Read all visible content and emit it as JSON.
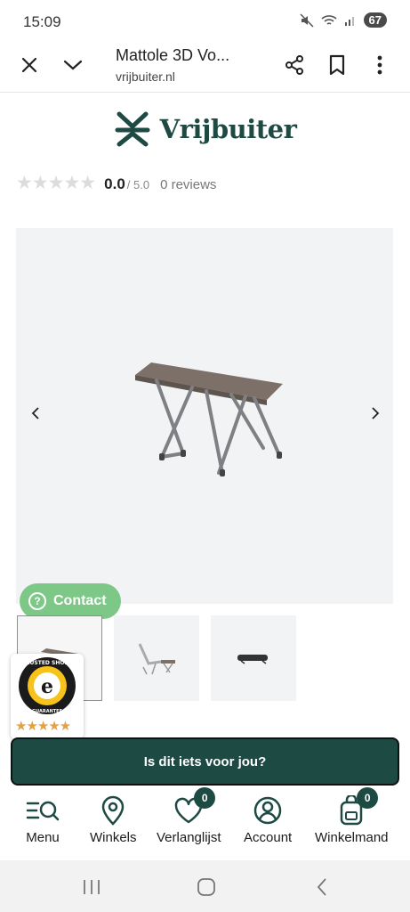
{
  "status": {
    "time": "15:09",
    "battery": "67"
  },
  "browser": {
    "title": "Mattole 3D Vo...",
    "url": "vrijbuiter.nl"
  },
  "brand": {
    "name": "Vrijbuiter",
    "color": "#1f4a44"
  },
  "rating": {
    "value": "0.0",
    "max": "/ 5.0",
    "reviews": "0 reviews",
    "stars": 0
  },
  "contact": {
    "label": "Contact",
    "color": "#7ec887"
  },
  "cta": {
    "label": "Is dit iets voor jou?"
  },
  "nav": {
    "menu": "Menu",
    "stores": "Winkels",
    "wishlist": "Verlanglijst",
    "wishlist_count": "0",
    "account": "Account",
    "cart": "Winkelmand",
    "cart_count": "0"
  },
  "trusted": {
    "rating_stars": 4.5
  }
}
